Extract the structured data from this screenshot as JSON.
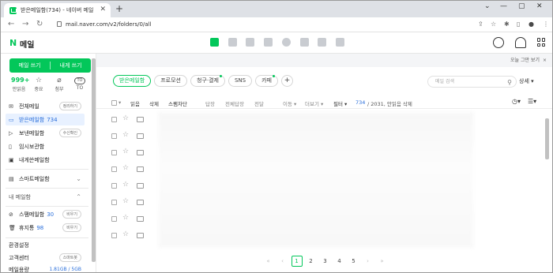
{
  "browser": {
    "tab_title": "받은메일함(734) - 네이버 메일",
    "tab_close": "✕",
    "new_tab": "+",
    "url": "mail.naver.com/v2/folders/0/all",
    "window_controls": [
      "⌄",
      "—",
      "▢",
      "✕"
    ],
    "nav_icons": [
      "←",
      "→",
      "↻"
    ],
    "right_icons": [
      "⇪",
      "☆",
      "✱",
      "▯",
      "●",
      "⋮"
    ]
  },
  "header": {
    "logo_n": "N",
    "logo_text": "메일"
  },
  "sidebar": {
    "write_label": "메일 쓰기",
    "self_write_label": "내게 쓰기",
    "quick": [
      {
        "value": "999+",
        "label": "안읽음",
        "icon": ""
      },
      {
        "value": "",
        "label": "중요",
        "icon": "☆"
      },
      {
        "value": "",
        "label": "첨부",
        "icon": "⌀"
      },
      {
        "value": "",
        "label": "TO",
        "icon": "TO"
      }
    ],
    "all_mail": "전체메일",
    "all_mail_pill": "정리하기",
    "inbox": "받은메일함",
    "inbox_count": "734",
    "sent": "보낸메일함",
    "sent_pill": "수신확인",
    "drafts": "임시보관함",
    "self_mail": "내게쓴메일함",
    "smart_mailbox": "스마트메일함",
    "my_mailbox": "내 메일함",
    "spam": "스팸메일함",
    "spam_count": "30",
    "spam_pill": "비우기",
    "trash": "휴지통",
    "trash_count": "98",
    "trash_pill": "비우기",
    "settings": "환경설정",
    "customer_center": "고객센터",
    "smart_bot_pill": "스마트봇",
    "usage_label": "메일용량",
    "usage_value": "1.81GB / 5GB"
  },
  "main": {
    "promo_text": "오늘 그만 보기",
    "promo_close": "×",
    "chips": [
      "받은메일함",
      "프로모션",
      "청구·결제",
      "SNS",
      "카페"
    ],
    "chip_plus": "+",
    "search_placeholder": "메일 검색",
    "detail_label": "상세 ▾",
    "toolbar": {
      "read": "읽음",
      "delete": "삭제",
      "spam_block": "스팸차단",
      "reply": "답장",
      "reply_all": "전체답장",
      "forward": "전달",
      "move": "이동 ▾",
      "more": "더보기 ▾",
      "filter": "필터 ▾",
      "count": "734",
      "count_rest": "/ 2031, 안읽음 삭제"
    },
    "pagination": [
      "«",
      "‹",
      "1",
      "2",
      "3",
      "4",
      "5",
      "›",
      "»"
    ],
    "current_page": "1"
  }
}
